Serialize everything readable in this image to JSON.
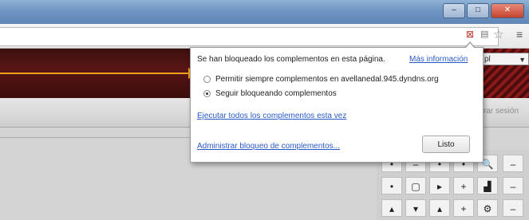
{
  "window": {
    "title": "",
    "minimize_glyph": "–",
    "maximize_glyph": "□",
    "close_glyph": "✕"
  },
  "toolbar": {
    "blocked_icon": "puzzle-blocked-icon",
    "page_icon": "page-icon",
    "star_icon": "bookmark-star-icon",
    "menu_icon": "wrench-menu-icon"
  },
  "page": {
    "language_value": "pl",
    "session_link": "rar sesión"
  },
  "popup": {
    "message": "Se han bloqueado los complementos en esta página.",
    "more_info": "Más información",
    "option_allow": "Permitir siempre complementos en avellanedal.945.dyndns.org",
    "option_block": "Seguir bloqueando complementos",
    "run_all_link": "Ejecutar todos los complementos esta vez",
    "manage_link": "Administrar bloqueo de complementos...",
    "done_button": "Listo",
    "selected_option": "option_block"
  },
  "pad": {
    "rows": [
      [
        "•",
        "–",
        "•",
        "•",
        "🔍",
        "–"
      ],
      [
        "•",
        "▢",
        "▸",
        "+",
        "▟",
        "–"
      ],
      [
        "▴",
        "▾",
        "▴",
        "+",
        "⚙",
        "–"
      ]
    ]
  },
  "colors": {
    "callout_arrow": "#f0a21a",
    "link": "#2a59c7",
    "banner": "#4a1212"
  }
}
